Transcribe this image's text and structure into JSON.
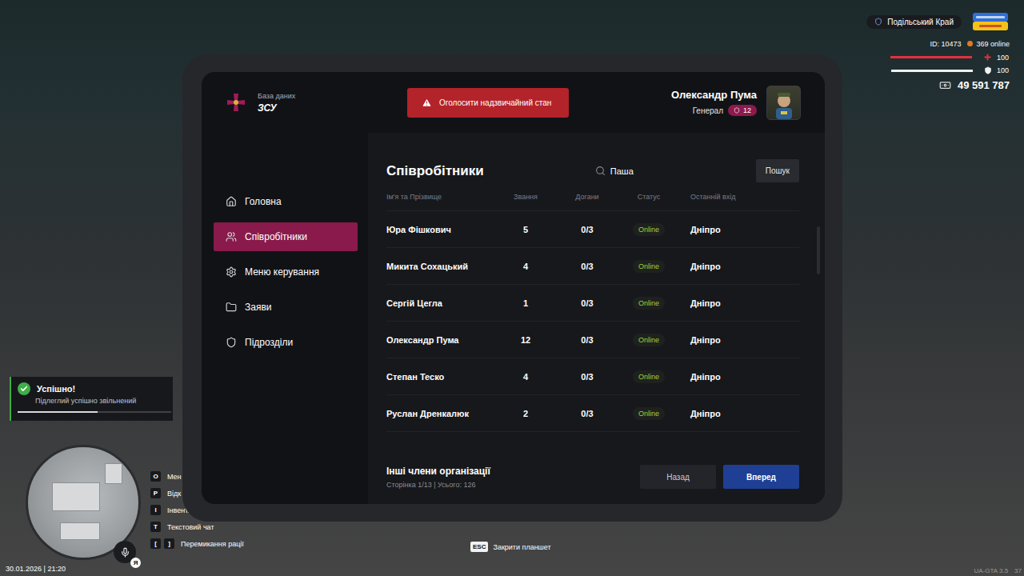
{
  "hud": {
    "server": "Подільський Край",
    "player_id": "ID: 10473",
    "online": "369 online",
    "health": {
      "reading": "100",
      "level": 1
    },
    "armor": {
      "reading": "100",
      "level": 1
    },
    "money": "49 591 787",
    "datetime": "30.01.2026 | 21:20",
    "version": "UA-GTA 3.5",
    "fps": "37"
  },
  "notification": {
    "title": "Успішно!",
    "message": "Підлеглий успішно звільнений",
    "level": 0.52
  },
  "keybinds": [
    {
      "keys": [
        "O"
      ],
      "label": "Мен"
    },
    {
      "keys": [
        "P"
      ],
      "label": "Відк"
    },
    {
      "keys": [
        "I"
      ],
      "label": "Інвент."
    },
    {
      "keys": [
        "T"
      ],
      "label": "Текстовий чат"
    },
    {
      "keys": [
        "[",
        "]"
      ],
      "label": "Перемикання рації"
    }
  ],
  "minimap": {
    "badge": "Я"
  },
  "close_hint": {
    "key": "ESC",
    "label": "Закрити планшет"
  },
  "tablet": {
    "brand": {
      "subtitle": "База даних",
      "title": "ЗСУ"
    },
    "alert_button": "Оголосити надзвичайний стан",
    "user": {
      "name": "Олександр Пума",
      "rank": "Генерал",
      "rank_level": "12"
    },
    "sidebar": {
      "items": [
        {
          "label": "Головна",
          "selected": false
        },
        {
          "label": "Співробітники",
          "selected": true
        },
        {
          "label": "Меню керування",
          "selected": false
        },
        {
          "label": "Заяви",
          "selected": false
        },
        {
          "label": "Підрозділи",
          "selected": false
        }
      ]
    },
    "page": {
      "title": "Співробітники",
      "search": {
        "value": "Паша",
        "button": "Пошук"
      },
      "table": {
        "columns": [
          "Ім'я та Прізвище",
          "Звання",
          "Догани",
          "Статус",
          "Останній вхід"
        ],
        "rows": [
          {
            "name": "Юра Фішкович",
            "rank": "5",
            "reprimands": "0/3",
            "status": "Online",
            "last_login": "Дніпро"
          },
          {
            "name": "Микита Сохацький",
            "rank": "4",
            "reprimands": "0/3",
            "status": "Online",
            "last_login": "Дніпро"
          },
          {
            "name": "Сергій Цегла",
            "rank": "1",
            "reprimands": "0/3",
            "status": "Online",
            "last_login": "Дніпро"
          },
          {
            "name": "Олександр Пума",
            "rank": "12",
            "reprimands": "0/3",
            "status": "Online",
            "last_login": "Дніпро"
          },
          {
            "name": "Степан Теско",
            "rank": "4",
            "reprimands": "0/3",
            "status": "Online",
            "last_login": "Дніпро"
          },
          {
            "name": "Руслан Дренкалюк",
            "rank": "2",
            "reprimands": "0/3",
            "status": "Online",
            "last_login": "Дніпро"
          }
        ]
      },
      "footer": {
        "title": "Інші члени організації",
        "pagination": "Сторінка 1/13 | Усього: 126",
        "buttons": [
          {
            "label": "Назад",
            "primary": false
          },
          {
            "label": "Вперед",
            "primary": true
          }
        ]
      }
    }
  }
}
